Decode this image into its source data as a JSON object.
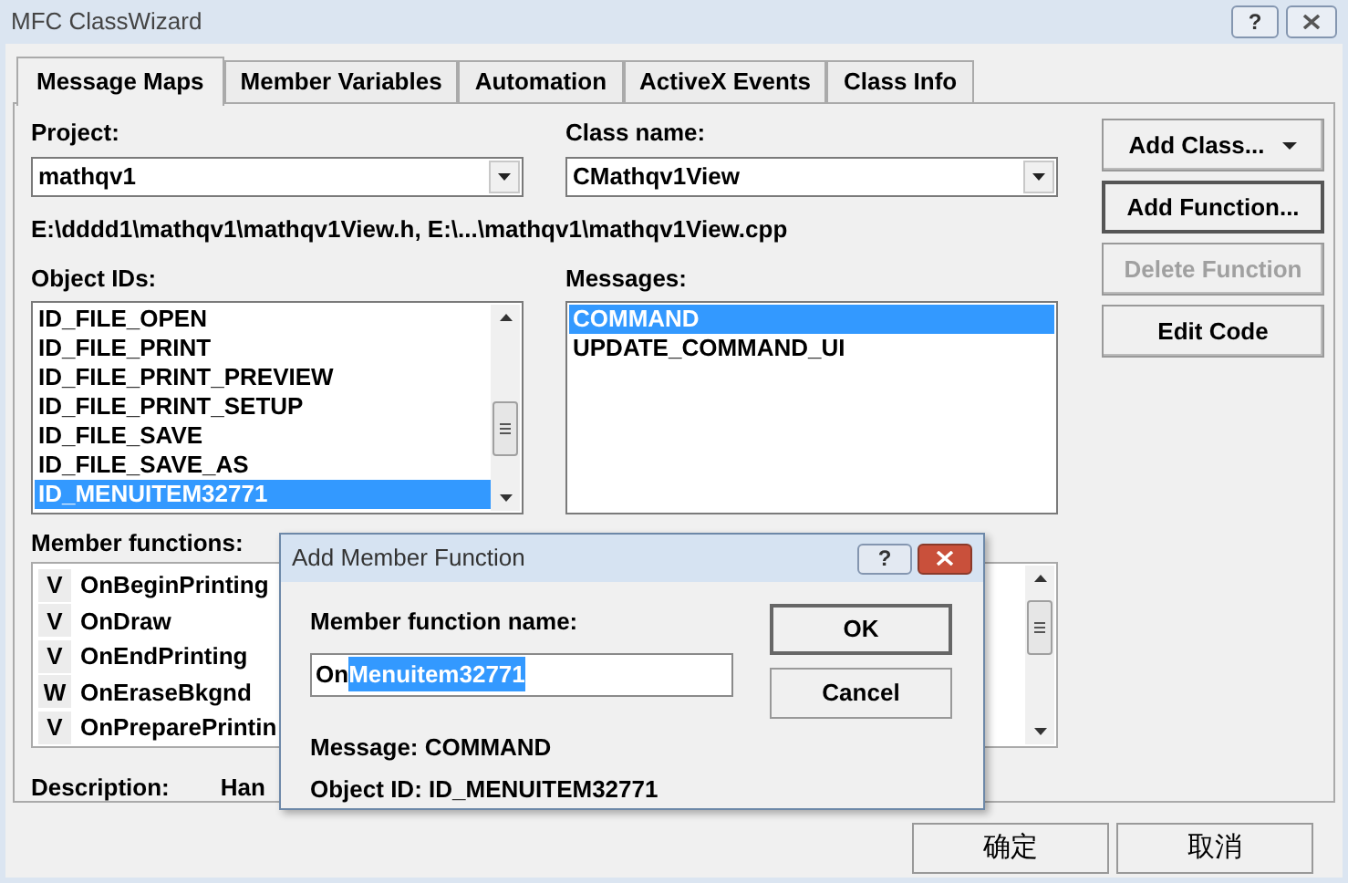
{
  "window": {
    "title": "MFC ClassWizard",
    "buttons": [
      "?"
    ]
  },
  "tabs": [
    {
      "label": "Message Maps",
      "selected": true
    },
    {
      "label": "Member Variables",
      "selected": false
    },
    {
      "label": "Automation",
      "selected": false
    },
    {
      "label": "ActiveX Events",
      "selected": false
    },
    {
      "label": "Class Info",
      "selected": false
    }
  ],
  "project": {
    "label": "Project:",
    "value": "mathqv1"
  },
  "class_name": {
    "label": "Class name:",
    "value": "CMathqv1View"
  },
  "path": "E:\\dddd1\\mathqv1\\mathqv1View.h, E:\\...\\mathqv1\\mathqv1View.cpp",
  "object_ids": {
    "label": "Object IDs:",
    "items": [
      {
        "text": "ID_FILE_OPEN",
        "selected": false
      },
      {
        "text": "ID_FILE_PRINT",
        "selected": false
      },
      {
        "text": "ID_FILE_PRINT_PREVIEW",
        "selected": false
      },
      {
        "text": "ID_FILE_PRINT_SETUP",
        "selected": false
      },
      {
        "text": "ID_FILE_SAVE",
        "selected": false
      },
      {
        "text": "ID_FILE_SAVE_AS",
        "selected": false
      },
      {
        "text": "ID_MENUITEM32771",
        "selected": true
      }
    ]
  },
  "messages": {
    "label": "Messages:",
    "items": [
      {
        "text": "COMMAND",
        "selected": true
      },
      {
        "text": "UPDATE_COMMAND_UI",
        "selected": false
      }
    ]
  },
  "side_buttons": [
    {
      "label": "Add Class...",
      "disabled": false,
      "dropdown": true,
      "default": false
    },
    {
      "label": "Add Function...",
      "disabled": false,
      "dropdown": false,
      "default": true
    },
    {
      "label": "Delete Function",
      "disabled": true,
      "dropdown": false,
      "default": false
    },
    {
      "label": "Edit Code",
      "disabled": false,
      "dropdown": false,
      "default": false
    }
  ],
  "member_functions": {
    "label": "Member functions:",
    "items": [
      {
        "type": "V",
        "name": "OnBeginPrinting"
      },
      {
        "type": "V",
        "name": "OnDraw"
      },
      {
        "type": "V",
        "name": "OnEndPrinting"
      },
      {
        "type": "W",
        "name": "OnEraseBkgnd"
      },
      {
        "type": "V",
        "name": "OnPreparePrintin"
      }
    ]
  },
  "description": {
    "label": "Description:",
    "value": "Han"
  },
  "bottom_buttons": [
    "确定",
    "取消"
  ],
  "dialog": {
    "title": "Add Member Function",
    "title_buttons": [
      "?"
    ],
    "field_label": "Member function name:",
    "value_parts": [
      {
        "text": "On",
        "selected": false
      },
      {
        "text": "Menuitem32771",
        "selected": true
      }
    ],
    "buttons": [
      "OK",
      "Cancel"
    ],
    "message": "Message: COMMAND",
    "object_id": "Object ID: ID_MENUITEM32771"
  }
}
